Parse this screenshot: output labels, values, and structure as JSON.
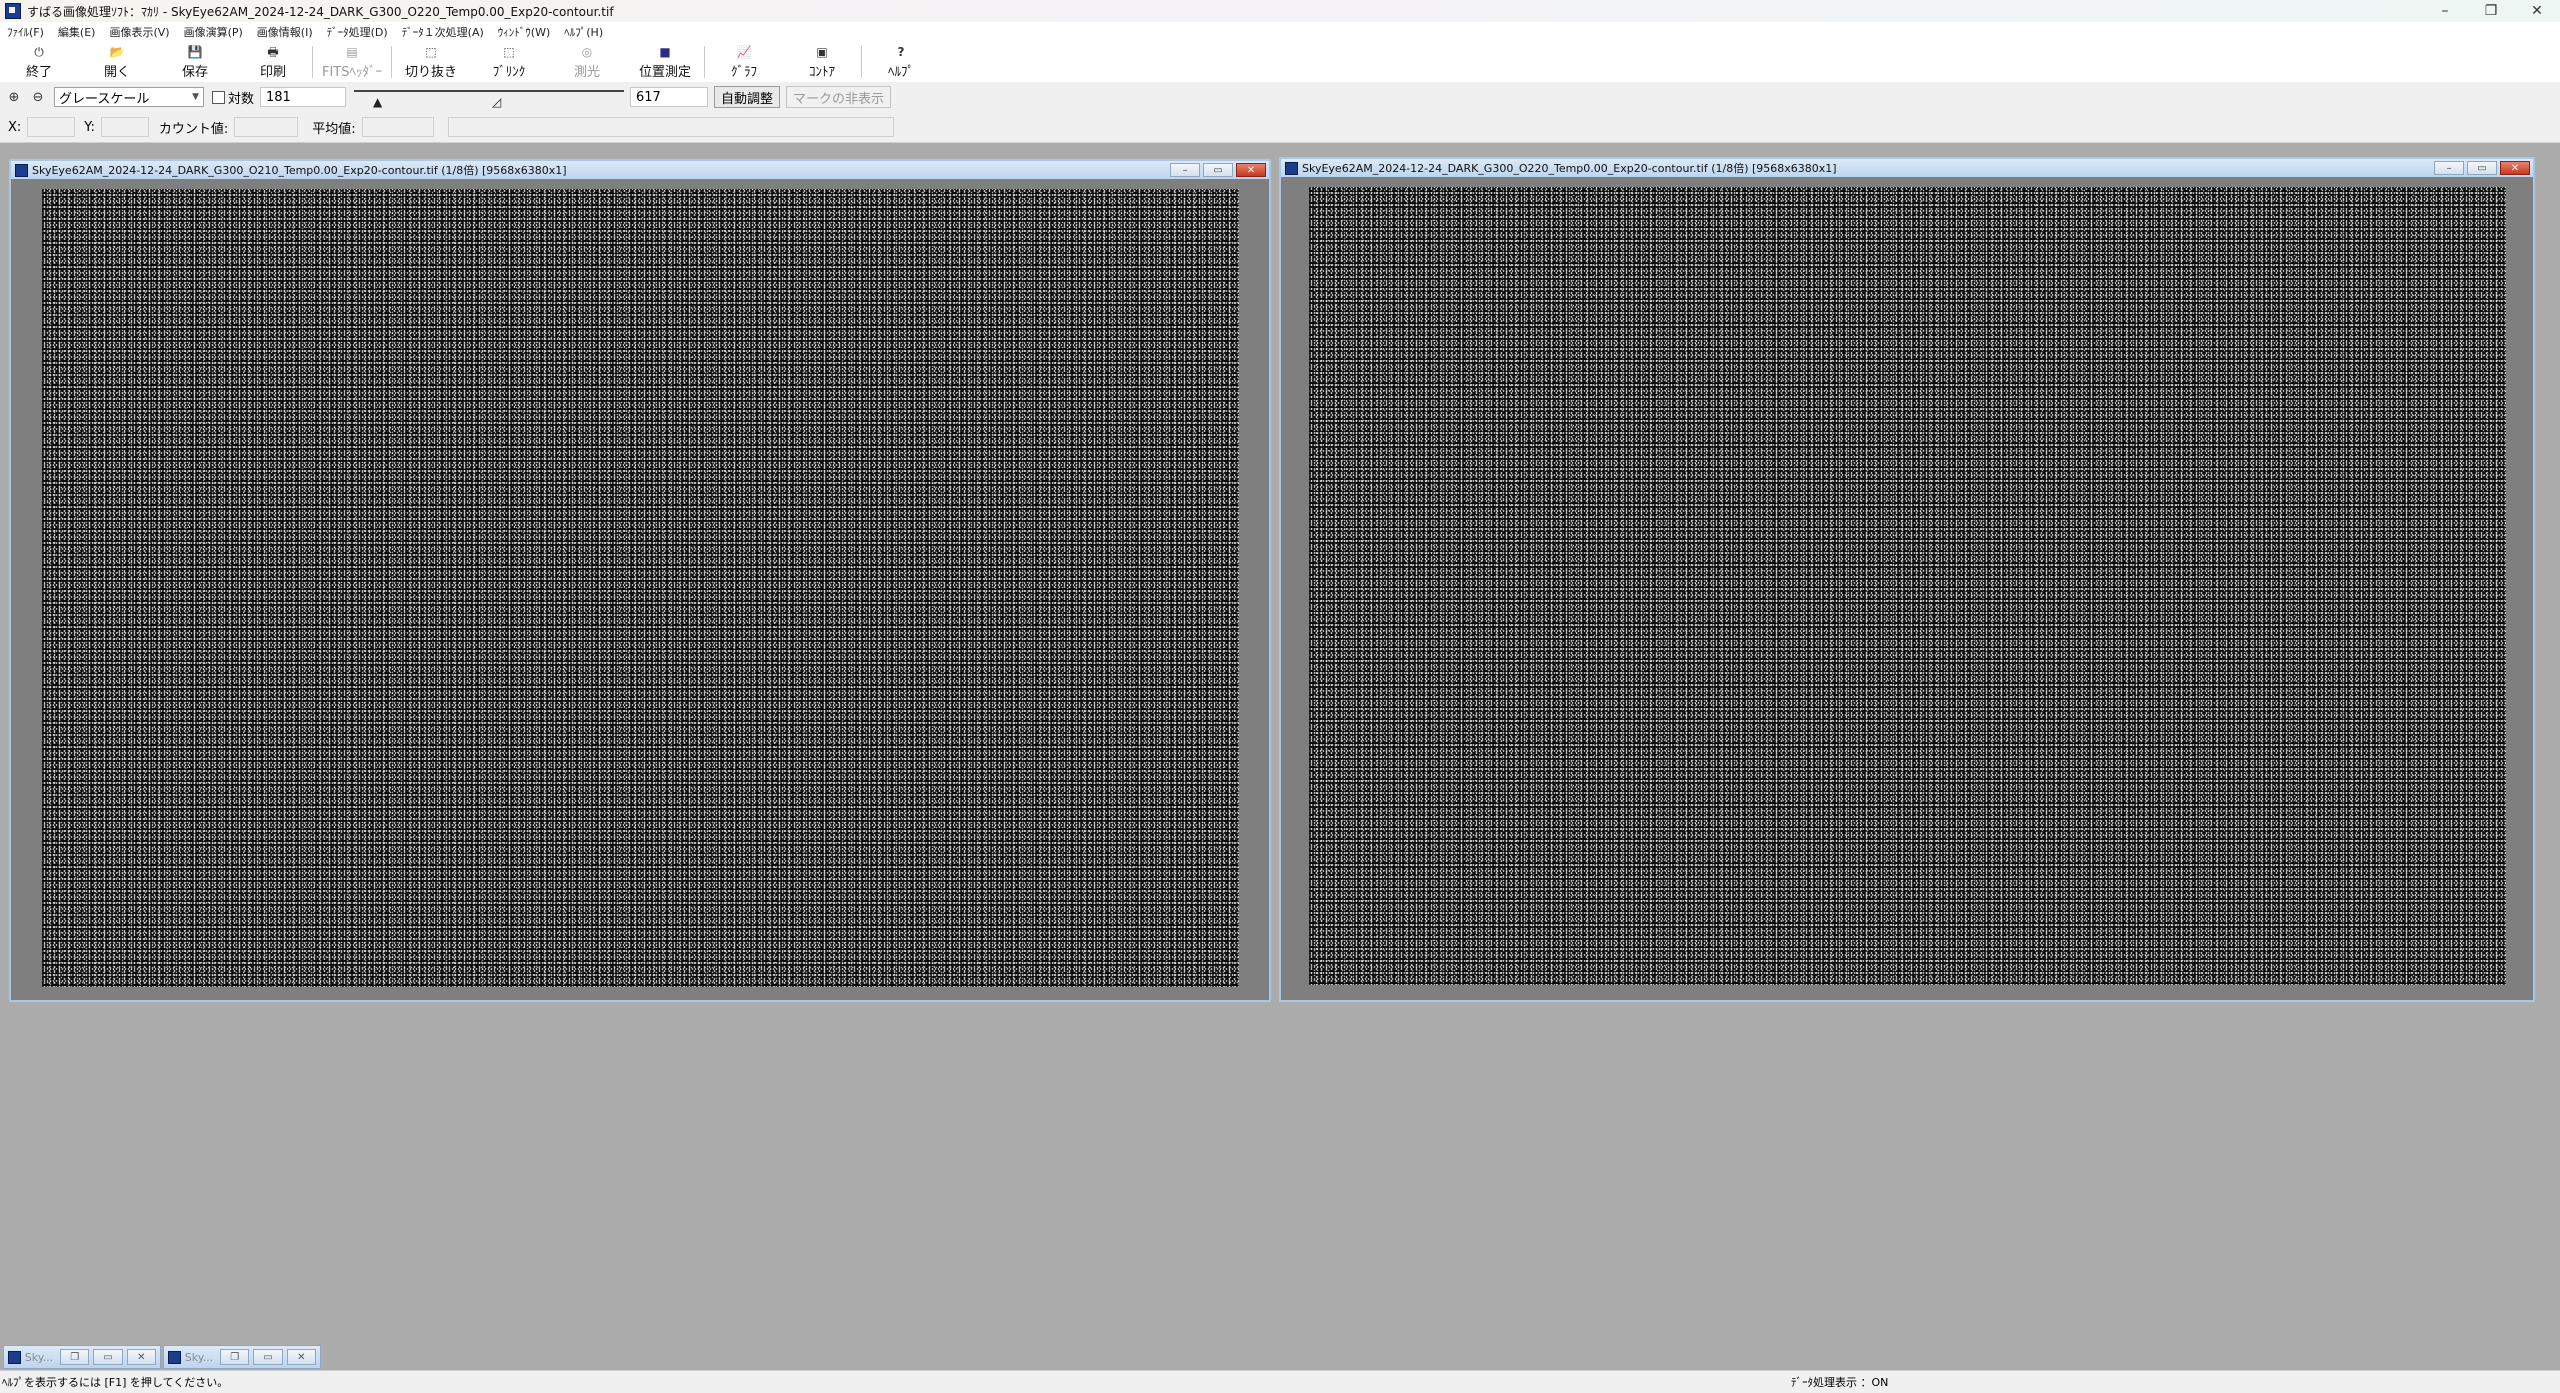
{
  "window": {
    "title": "すばる画像処理ｿﾌﾄ：ﾏｶﾘ - SkyEye62AM_2024-12-24_DARK_G300_O220_Temp0.00_Exp20-contour.tif",
    "controls": {
      "minimize": "–",
      "restore": "❐",
      "close": "✕"
    }
  },
  "menu": {
    "items": [
      "ﾌｧｲﾙ(F)",
      "編集(E)",
      "画像表示(V)",
      "画像演算(P)",
      "画像情報(I)",
      "ﾃﾞｰﾀ処理(D)",
      "ﾃﾞｰﾀ１次処理(A)",
      "ｳｨﾝﾄﾞｳ(W)",
      "ﾍﾙﾌﾟ(H)"
    ]
  },
  "toolbar": {
    "buttons": [
      {
        "label": "終了",
        "icon": "⏻"
      },
      {
        "label": "開く",
        "icon": "📂"
      },
      {
        "label": "保存",
        "icon": "💾"
      },
      {
        "label": "印刷",
        "icon": "🖶"
      },
      {
        "label": "FITSﾍｯﾀﾞｰ",
        "icon": "▤"
      },
      {
        "label": "切り抜き",
        "icon": "⬚"
      },
      {
        "label": "ﾌﾞﾘﾝｸ",
        "icon": "⬚"
      },
      {
        "label": "測光",
        "icon": "◎"
      },
      {
        "label": "位置測定",
        "icon": "■"
      },
      {
        "label": "ｸﾞﾗﾌ",
        "icon": "📈"
      },
      {
        "label": "ｺﾝﾄｱ",
        "icon": "▣"
      },
      {
        "label": "ﾍﾙﾌﾟ",
        "icon": "?"
      }
    ]
  },
  "display": {
    "zoom_in_icon": "⊕",
    "zoom_out_icon": "⊖",
    "scale_mode": "グレースケール",
    "log_label": "対数",
    "min_value": "181",
    "max_value": "617",
    "slider_min_fraction": 0.09,
    "slider_max_fraction": 0.53,
    "auto_adjust_label": "自動調整",
    "hide_marks_label": "マークの非表示"
  },
  "coords": {
    "x_label": "X:",
    "y_label": "Y:",
    "count_label": "カウント値:",
    "mean_label": "平均値:"
  },
  "image_windows": [
    {
      "title": "SkyEye62AM_2024-12-24_DARK_G300_O210_Temp0.00_Exp20-contour.tif (1/8倍) [9568x6380x1]"
    },
    {
      "title": "SkyEye62AM_2024-12-24_DARK_G300_O220_Temp0.00_Exp20-contour.tif (1/8倍) [9568x6380x1]"
    }
  ],
  "minimized_windows": [
    {
      "title": "Sky..."
    },
    {
      "title": "Sky..."
    }
  ],
  "status": {
    "help_text": "ﾍﾙﾌﾟを表示するには [F1] を押してください。",
    "data_mode": "ﾃﾞｰﾀ処理表示 ：ON"
  }
}
